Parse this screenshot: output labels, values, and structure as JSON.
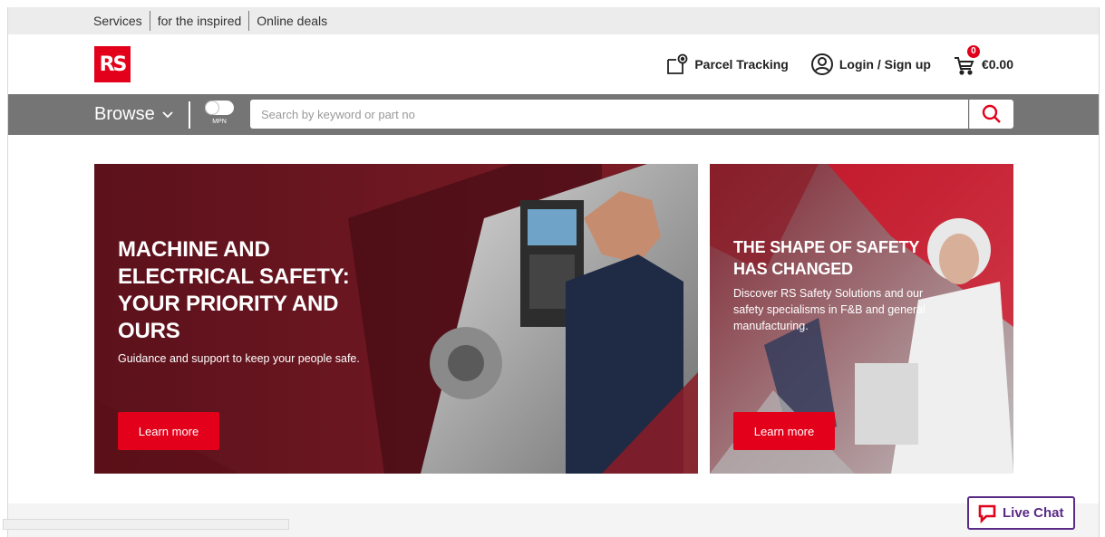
{
  "utility_bar": {
    "links": [
      "Services",
      "for the inspired",
      "Online deals"
    ]
  },
  "header": {
    "logo_text": "RS",
    "parcel_tracking": "Parcel Tracking",
    "login": "Login / Sign up",
    "cart_count": "0",
    "cart_total": "€0.00"
  },
  "search": {
    "browse_label": "Browse",
    "mpn_label": "MPN",
    "placeholder": "Search by keyword or part no"
  },
  "banners": [
    {
      "title": "MACHINE AND ELECTRICAL SAFETY: YOUR PRIORITY AND OURS",
      "description": "Guidance and support to keep your people safe.",
      "button": "Learn more"
    },
    {
      "title": "THE SHAPE OF SAFETY HAS CHANGED",
      "description": "Discover RS Safety Solutions and our safety specialisms in F&B and general manufacturing.",
      "button": "Learn more"
    }
  ],
  "live_chat": "Live Chat",
  "colors": {
    "brand_red": "#e2001a",
    "search_bar_gray": "#757575",
    "live_chat_purple": "#5b2a86"
  }
}
